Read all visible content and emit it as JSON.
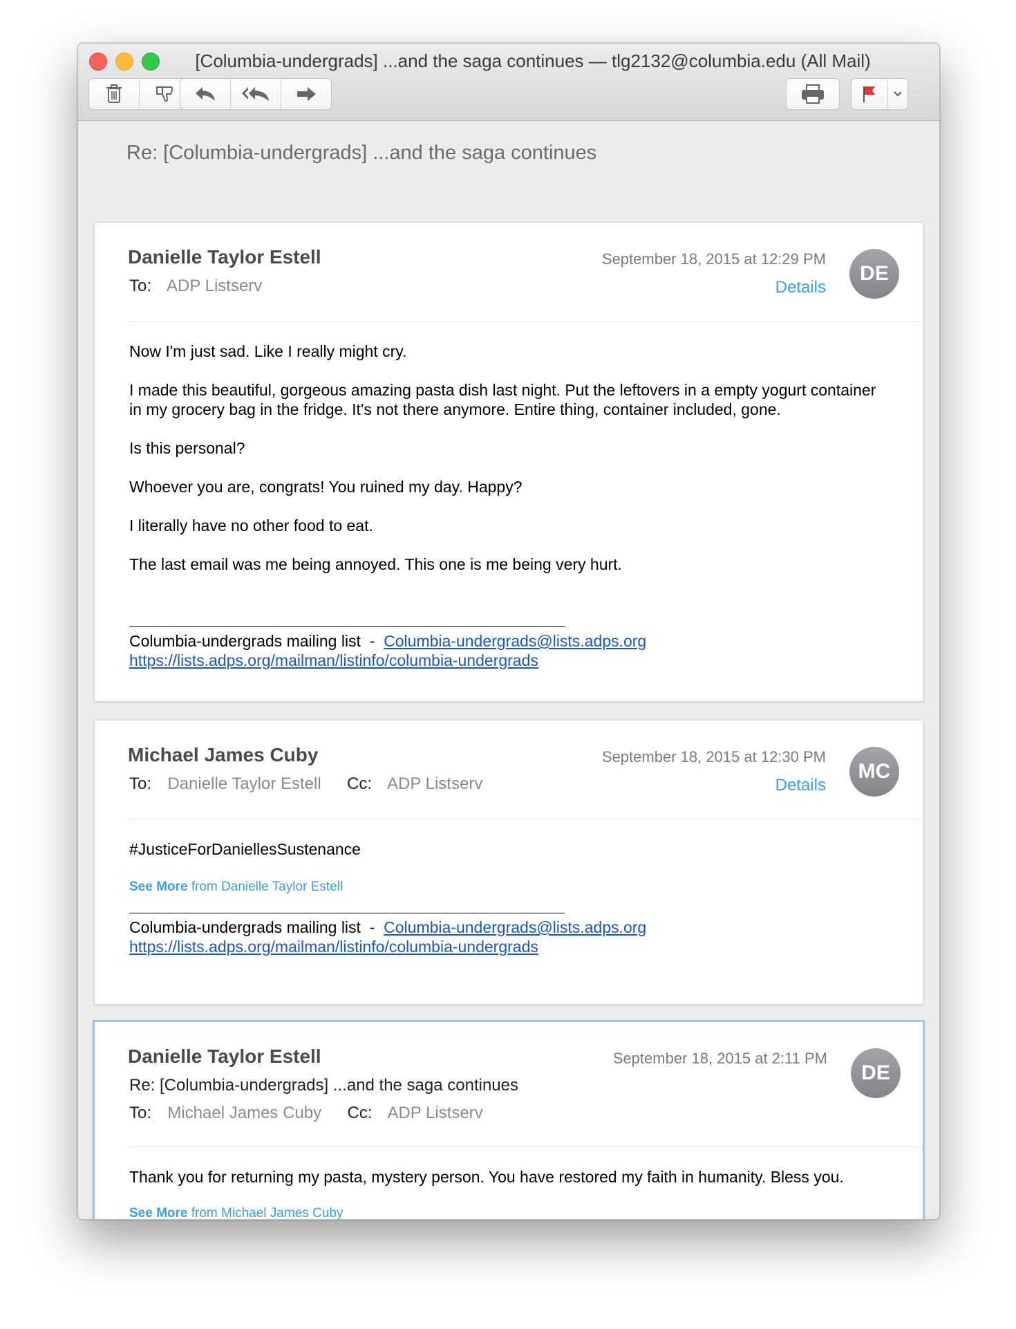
{
  "window": {
    "title": "[Columbia-undergrads] ...and the saga continues — tlg2132@columbia.edu (All Mail)"
  },
  "toolbar": {
    "icons": [
      "trash-icon",
      "junk-icon",
      "reply-icon",
      "reply-all-icon",
      "forward-icon",
      "print-icon",
      "flag-icon",
      "chevron-down-icon"
    ],
    "flag_color": "#e8352b"
  },
  "thread": {
    "subject": "Re: [Columbia-undergrads] ...and the saga continues"
  },
  "messages": [
    {
      "sender": "Danielle Taylor Estell",
      "date": "September 18, 2015 at 12:29 PM",
      "details_label": "Details",
      "avatar_initials": "DE",
      "to_label": "To:",
      "to": "ADP Listserv",
      "body": [
        "Now I'm just sad. Like I really might cry.",
        "I made this beautiful, gorgeous amazing pasta dish last night. Put the leftovers in a empty yogurt container in my grocery bag in the fridge. It's not there anymore. Entire thing, container included, gone.",
        "Is this personal?",
        "Whoever you are, congrats! You ruined my day. Happy?",
        "I literally have no other food to eat.",
        "The last email was me being annoyed. This one is me being very hurt."
      ],
      "footer_text": "Columbia-undergrads mailing list  -  ",
      "footer_email": "Columbia-undergrads@lists.adps.org",
      "footer_url": "https://lists.adps.org/mailman/listinfo/columbia-undergrads"
    },
    {
      "sender": "Michael James Cuby",
      "date": "September 18, 2015 at 12:30 PM",
      "details_label": "Details",
      "avatar_initials": "MC",
      "to_label": "To:",
      "to": "Danielle Taylor Estell",
      "cc_label": "Cc:",
      "cc": "ADP Listserv",
      "body": [
        "#JusticeForDaniellesSustenance"
      ],
      "see_more_bold": "See More",
      "see_more_rest": " from Danielle Taylor Estell",
      "footer_text": "Columbia-undergrads mailing list  -  ",
      "footer_email": "Columbia-undergrads@lists.adps.org",
      "footer_url": "https://lists.adps.org/mailman/listinfo/columbia-undergrads"
    },
    {
      "sender": "Danielle Taylor Estell",
      "date": "September 18, 2015 at 2:11 PM",
      "avatar_initials": "DE",
      "subject_line": "Re: [Columbia-undergrads] ...and the saga continues",
      "to_label": "To:",
      "to": "Michael James Cuby",
      "cc_label": "Cc:",
      "cc": "ADP Listserv",
      "body": [
        "Thank you for returning my pasta, mystery person. You have restored my faith in humanity. Bless you."
      ],
      "see_more_bold": "See More",
      "see_more_rest": " from Michael James Cuby"
    }
  ]
}
